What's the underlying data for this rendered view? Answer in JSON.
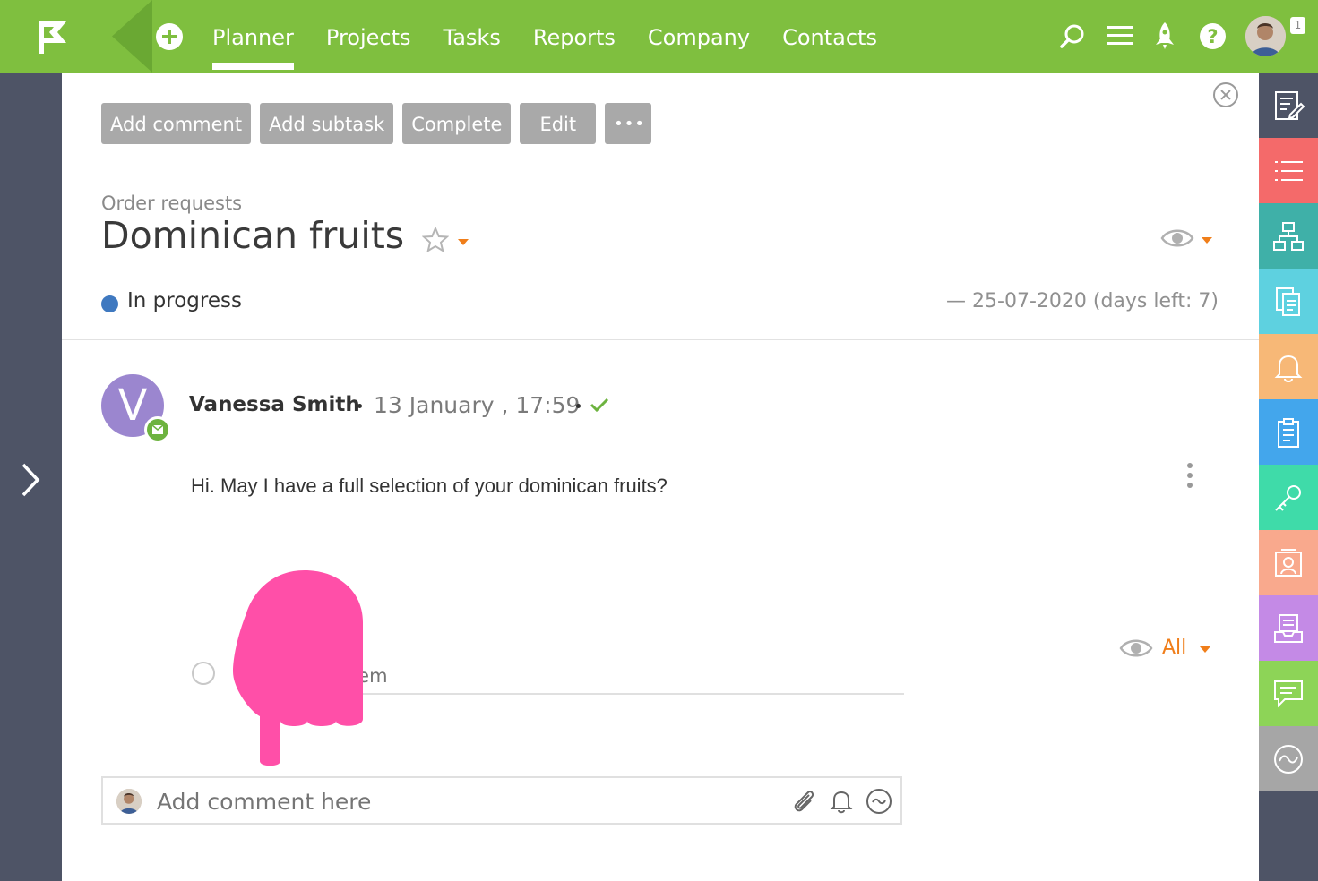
{
  "nav": {
    "items": [
      {
        "label": "Planner",
        "active": true
      },
      {
        "label": "Projects"
      },
      {
        "label": "Tasks"
      },
      {
        "label": "Reports"
      },
      {
        "label": "Company"
      },
      {
        "label": "Contacts"
      }
    ],
    "notification_count": "1",
    "icons": [
      "add-icon",
      "search-icon",
      "menu-icon",
      "rocket-icon",
      "help-icon",
      "user-avatar"
    ]
  },
  "toolbar": {
    "add_comment": "Add comment",
    "add_subtask": "Add subtask",
    "complete": "Complete",
    "edit": "Edit",
    "more": "•••"
  },
  "task": {
    "project": "Order requests",
    "title": "Dominican fruits",
    "status": "In progress",
    "status_color": "#3f79c0",
    "due": "— 25-07-2020 (days left: 7)"
  },
  "comment": {
    "avatar_letter": "V",
    "author": "Vanessa Smith",
    "date": "13 January , 17:59",
    "text": "Hi. May I have a full selection of your dominican fruits?"
  },
  "checklist": {
    "visibility": "All",
    "placeholder": "Checklist item"
  },
  "comment_box": {
    "placeholder": "Add comment here"
  },
  "right_rail": {
    "buttons": [
      {
        "name": "notes-icon",
        "color": "#4e5466"
      },
      {
        "name": "list-icon",
        "color": "#f46a6a"
      },
      {
        "name": "hierarchy-icon",
        "color": "#3fb0a8"
      },
      {
        "name": "documents-icon",
        "color": "#5ed1e0"
      },
      {
        "name": "bell-icon",
        "color": "#f7b877"
      },
      {
        "name": "clipboard-icon",
        "color": "#43a6ec"
      },
      {
        "name": "key-icon",
        "color": "#3fdba9"
      },
      {
        "name": "contact-card-icon",
        "color": "#f9a98d"
      },
      {
        "name": "inbox-icon",
        "color": "#c48ae6"
      },
      {
        "name": "chat-icon",
        "color": "#8dd457"
      },
      {
        "name": "activity-icon",
        "color": "#a6a6a6"
      }
    ]
  },
  "colors": {
    "brand_green": "#7fbf3f",
    "accent_orange": "#f07e1a",
    "rail_dark": "#4e5466",
    "button_gray": "#a9a9a9"
  }
}
